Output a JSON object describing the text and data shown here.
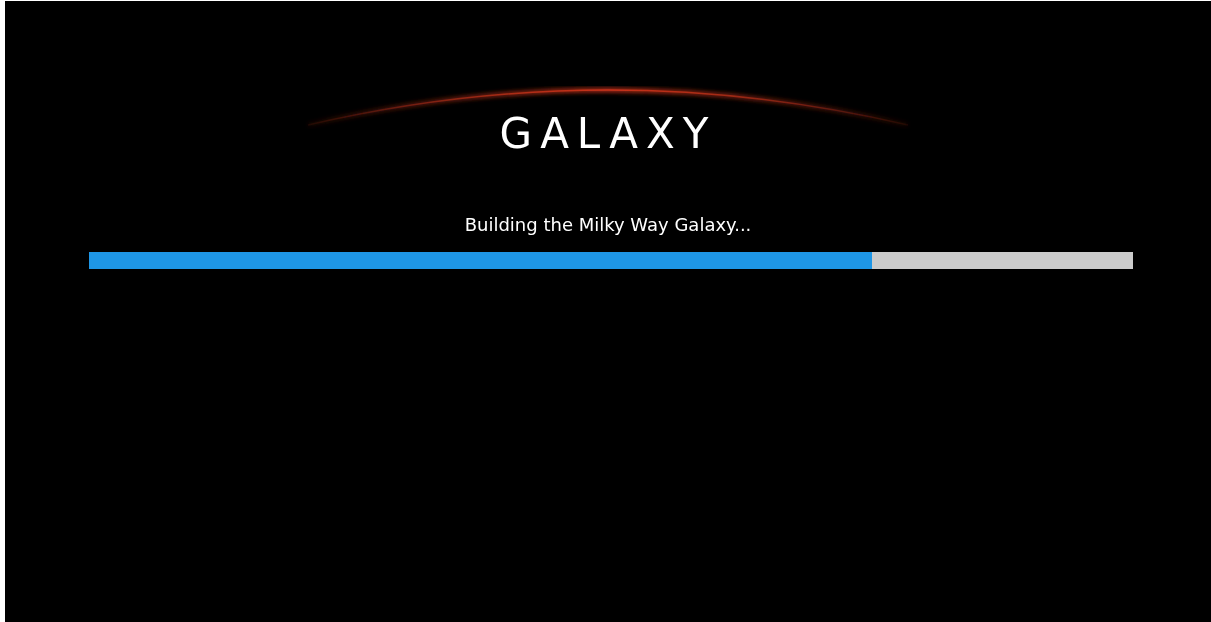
{
  "title": "GALAXY",
  "status": "Building the Milky Way Galaxy...",
  "progress": {
    "level": 0.75
  }
}
